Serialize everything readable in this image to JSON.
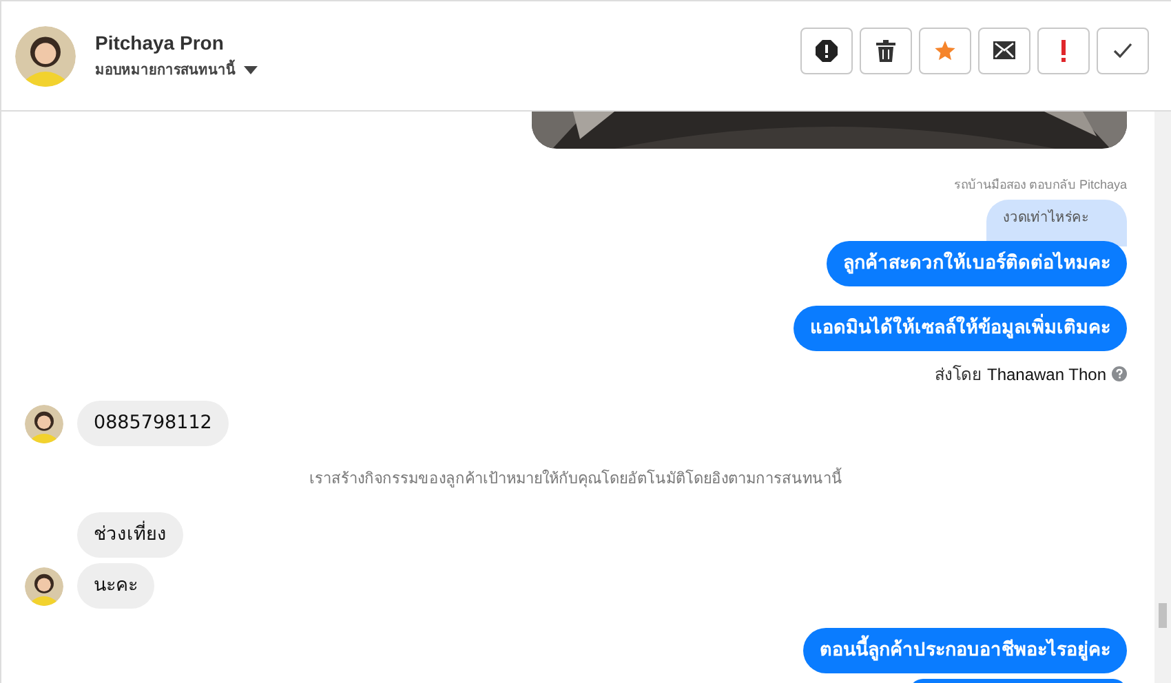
{
  "header": {
    "name": "Pitchaya Pron",
    "assign": "มอบหมายการสนทนานี้",
    "actions": [
      {
        "kind": "spam"
      },
      {
        "kind": "delete"
      },
      {
        "kind": "star"
      },
      {
        "kind": "unread"
      },
      {
        "kind": "important"
      },
      {
        "kind": "done"
      }
    ]
  },
  "messages": [
    {
      "kind": "picture"
    },
    {
      "kind": "reply",
      "meta": "รถบ้านมือสอง ตอบกลับ Pitchaya",
      "quote": "งวดเท่าไหร่คะ",
      "text": "ลูกค้าสะดวกให้เบอร์ติดต่อไหมคะ"
    },
    {
      "kind": "outgoing",
      "text": "แอดมินได้ให้เซลล์ให้ข้อมูลเพิ่มเติมคะ",
      "sent_by_label": "ส่งโดย",
      "sent_by": "Thanawan Thon"
    },
    {
      "kind": "incoming",
      "text": "0885798112",
      "avatar": true
    },
    {
      "kind": "system",
      "text": "เราสร้างกิจกรรมของลูกค้าเป้าหมายให้กับคุณโดยอัตโนมัติโดยอิงตามการสนทนานี้"
    },
    {
      "kind": "incoming",
      "text": "ช่วงเที่ยง",
      "avatar": false
    },
    {
      "kind": "incoming",
      "text": "นะคะ",
      "avatar": true
    },
    {
      "kind": "outgoing",
      "text": "ตอนนี้ลูกค้าประกอบอาชีพอะไรอยู่คะ"
    },
    {
      "kind": "cut"
    }
  ]
}
